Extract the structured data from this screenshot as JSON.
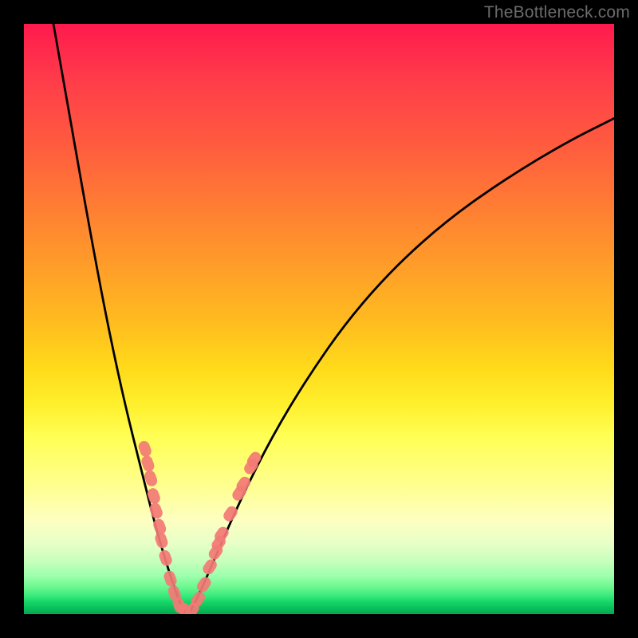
{
  "watermark": "TheBottleneck.com",
  "colors": {
    "curve": "#000000",
    "dots": "#f37a75",
    "dots_stroke": "#e46a66",
    "frame": "#000000"
  },
  "chart_data": {
    "type": "line",
    "title": "",
    "xlabel": "",
    "ylabel": "",
    "xlim": [
      0,
      100
    ],
    "ylim": [
      0,
      100
    ],
    "notes": "V-shaped bottleneck curve. Gradient background red→yellow→green. Y encodes bottleneck severity (higher = worse). Minimum near x≈27 at y≈0. Scattered pink data points clustered on both arms of the V near the bottom.",
    "series": [
      {
        "name": "curve-left",
        "x": [
          5,
          8,
          11,
          14,
          17,
          20,
          22,
          24,
          26,
          27,
          28
        ],
        "y": [
          100,
          83,
          66,
          50,
          36,
          24,
          16,
          9,
          3,
          0.5,
          0
        ]
      },
      {
        "name": "curve-right",
        "x": [
          28,
          30,
          33,
          37,
          42,
          48,
          55,
          63,
          72,
          82,
          92,
          100
        ],
        "y": [
          0,
          4,
          11,
          20,
          30,
          40,
          50,
          59,
          67,
          74,
          80,
          84
        ]
      }
    ],
    "points": [
      {
        "x": 20.5,
        "y": 28.0
      },
      {
        "x": 21.0,
        "y": 25.5
      },
      {
        "x": 21.5,
        "y": 23.0
      },
      {
        "x": 22.0,
        "y": 20.0
      },
      {
        "x": 22.4,
        "y": 17.5
      },
      {
        "x": 23.0,
        "y": 14.8
      },
      {
        "x": 23.3,
        "y": 12.5
      },
      {
        "x": 24.0,
        "y": 9.5
      },
      {
        "x": 24.8,
        "y": 6.0
      },
      {
        "x": 25.5,
        "y": 3.5
      },
      {
        "x": 26.3,
        "y": 1.5
      },
      {
        "x": 27.2,
        "y": 0.6
      },
      {
        "x": 28.5,
        "y": 0.7
      },
      {
        "x": 29.5,
        "y": 2.5
      },
      {
        "x": 30.5,
        "y": 5.0
      },
      {
        "x": 31.5,
        "y": 8.0
      },
      {
        "x": 32.5,
        "y": 10.5
      },
      {
        "x": 33.0,
        "y": 12.0
      },
      {
        "x": 33.5,
        "y": 13.5
      },
      {
        "x": 35.0,
        "y": 17.0
      },
      {
        "x": 36.5,
        "y": 20.5
      },
      {
        "x": 37.2,
        "y": 22.0
      },
      {
        "x": 38.5,
        "y": 25.0
      },
      {
        "x": 39.0,
        "y": 26.2
      }
    ]
  }
}
